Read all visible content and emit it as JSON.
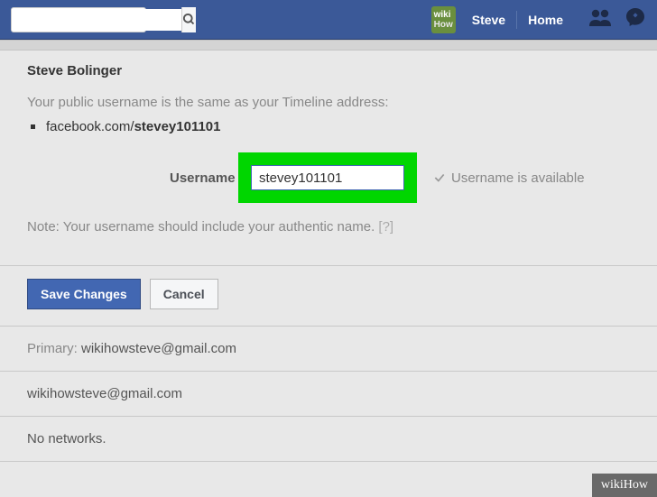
{
  "topbar": {
    "search_placeholder": "",
    "logo_line1": "wiki",
    "logo_line2": "How",
    "profile_link": "Steve",
    "home_link": "Home"
  },
  "settings": {
    "user_name": "Steve Bolinger",
    "public_desc": "Your public username is the same as your Timeline address:",
    "url_prefix": "facebook.com/",
    "url_username": "stevey101101",
    "username_label": "Username",
    "username_value": "stevey101101",
    "availability": "Username is available",
    "note_text": "Note: Your username should include your authentic name.",
    "help_marker": "[?]",
    "save_label": "Save Changes",
    "cancel_label": "Cancel"
  },
  "contact": {
    "primary_label": "Primary:",
    "primary_email": "wikihowsteve@gmail.com",
    "email": "wikihowsteve@gmail.com",
    "networks": "No networks."
  },
  "watermark": "wikiHow"
}
